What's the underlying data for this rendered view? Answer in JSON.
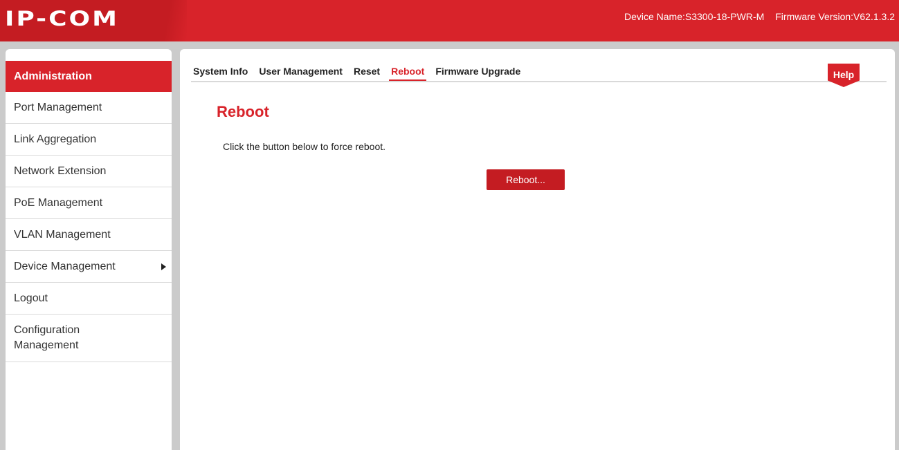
{
  "header": {
    "logo": "IP-COM",
    "device_name": "Device Name:S3300-18-PWR-M",
    "firmware_version": "Firmware Version:V62.1.3.2"
  },
  "sidebar": {
    "header": "Administration",
    "items": [
      {
        "label": "Port Management"
      },
      {
        "label": "Link Aggregation"
      },
      {
        "label": "Network Extension"
      },
      {
        "label": "PoE Management"
      },
      {
        "label": "VLAN Management"
      },
      {
        "label": "Device Management"
      },
      {
        "label": "Logout"
      },
      {
        "label": "Configuration Management"
      }
    ]
  },
  "tabs": [
    {
      "label": "System Info"
    },
    {
      "label": "User Management"
    },
    {
      "label": "Reset"
    },
    {
      "label": "Reboot",
      "active": true
    },
    {
      "label": "Firmware Upgrade"
    }
  ],
  "help_label": "Help",
  "content": {
    "title": "Reboot",
    "description": "Click the button below to force reboot.",
    "button_label": "Reboot..."
  },
  "colors": {
    "brand_red": "#d8232a",
    "background": "#cbcbcb"
  },
  "icons": [
    "chevron-right-icon"
  ]
}
